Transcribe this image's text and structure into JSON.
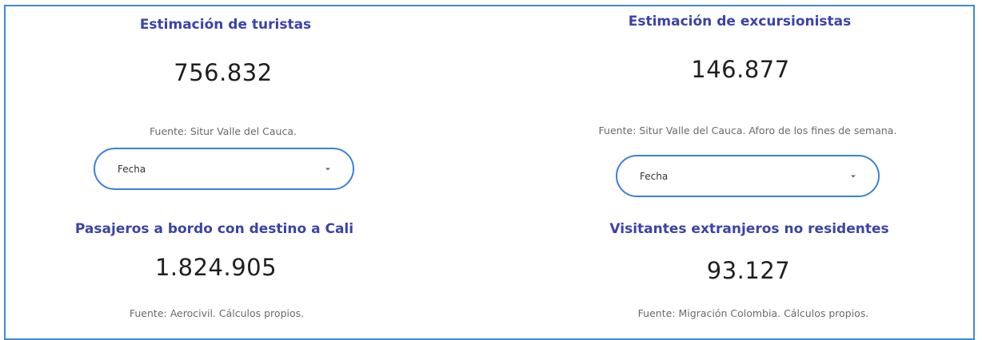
{
  "cards": [
    {
      "title": "Estimación de turistas",
      "value": "756.832",
      "source": "Fuente: Situr Valle del Cauca.",
      "select": {
        "value": "Fecha"
      }
    },
    {
      "title": "Estimación de excursionistas",
      "value": "146.877",
      "source": "Fuente: Situr Valle del Cauca. Aforo de los fines de semana.",
      "select": {
        "value": "Fecha"
      }
    },
    {
      "title": "Pasajeros a bordo con destino a Cali",
      "value": "1.824.905",
      "source": "Fuente: Aerocivil. Cálculos propios."
    },
    {
      "title": "Visitantes extranjeros no residentes",
      "value": "93.127",
      "source": "Fuente: Migración Colombia. Cálculos propios."
    }
  ],
  "colors": {
    "title": "#3b43a8",
    "value": "#1f1f1f",
    "source": "#6a6a6a",
    "select_border": "#3b7fe0",
    "frame_border": "#3d8ad6"
  },
  "icons": {
    "select_caret": "caret-down-icon"
  }
}
